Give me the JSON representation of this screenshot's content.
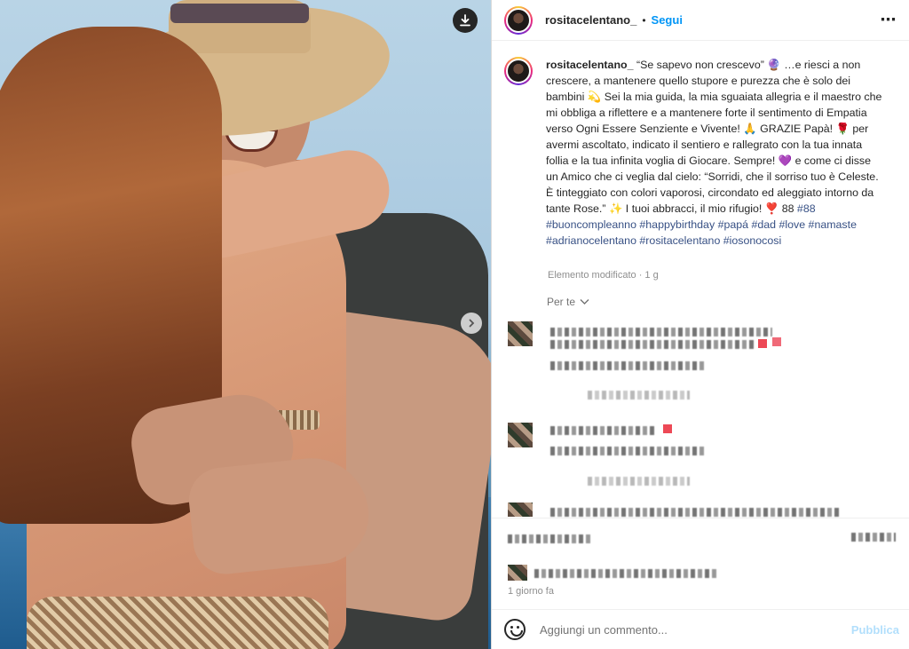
{
  "post": {
    "username": "rositacelentano_",
    "separator": "•",
    "follow_label": "Segui",
    "more_icon": "⋯"
  },
  "caption": {
    "username": "rositacelentano_",
    "text": "“Se sapevo non crescevo” 🔮 …e riesci a non crescere, a mantenere quello stupore e purezza che è solo dei bambini 💫 Sei la mia guida, la mia sguaiata allegria e il maestro che mi obbliga a riflettere e a mantenere forte il sentimento di Empatia verso Ogni Essere Senziente e Vivente! 🙏 GRAZIE Papà! 🌹 per avermi ascoltato, indicato il sentiero e rallegrato con la tua innata follia e la tua infinita voglia di Giocare. Sempre! 💜 e come ci disse un Amico che ci veglia dal cielo: “Sorridi, che il sorriso tuo è Celeste. È tinteggiato con colori vaporosi, circondato ed aleggiato intorno da tante Rose.” ✨ I tuoi abbracci, il mio rifugio! ❣️ 88 ",
    "hashtags": "#88 #buoncompleanno #happybirthday #papá #dad #love #namaste #adrianocelentano #rositacelentano #iosonocosi",
    "edited": "Elemento modificato · 1 g"
  },
  "comments": {
    "for_you_label": "Per te",
    "chevron_icon": "⌄"
  },
  "footer": {
    "time_ago": "1 giorno fa",
    "comment_placeholder": "Aggiungi un commento...",
    "post_label": "Pubblica"
  },
  "colors": {
    "accent": "#0095f6",
    "hashtag": "#385185",
    "post_disabled": "#b2dffc",
    "secondary_text": "#8e8e8e"
  }
}
